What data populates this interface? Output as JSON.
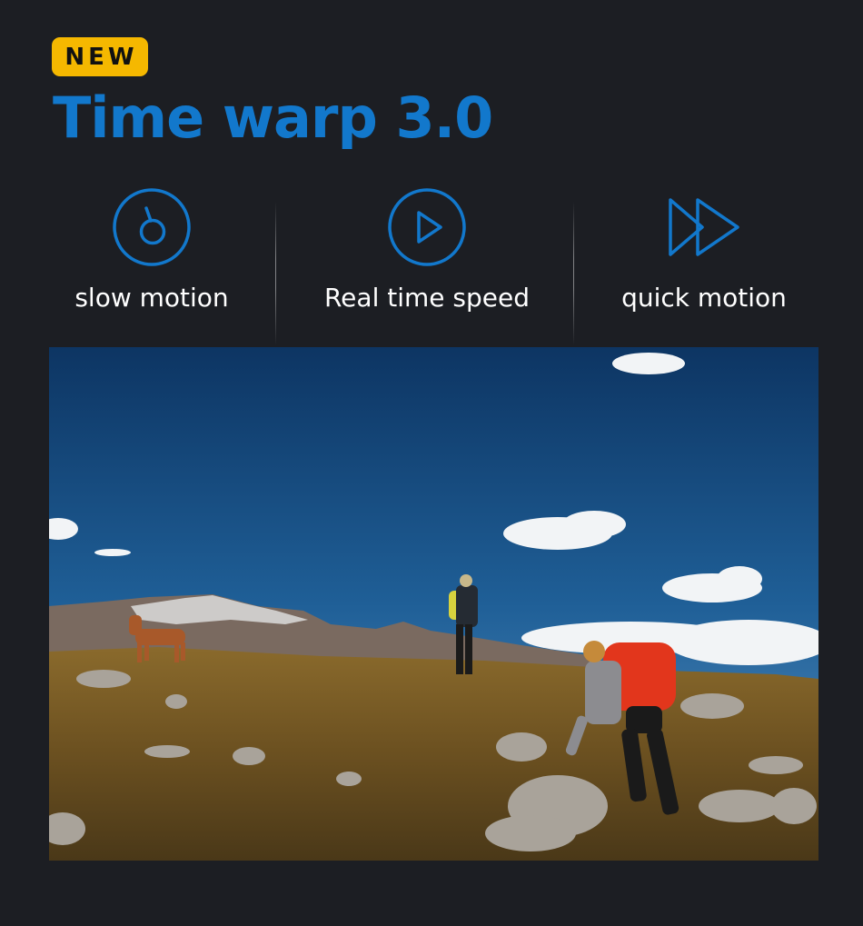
{
  "badge": {
    "label": "NEW"
  },
  "header": {
    "title": "Time warp 3.0"
  },
  "features": [
    {
      "label": "slow motion",
      "icon": "slow-motion-icon"
    },
    {
      "label": "Real time speed",
      "icon": "play-icon"
    },
    {
      "label": "quick motion",
      "icon": "fast-forward-icon"
    }
  ],
  "colors": {
    "background": "#1c1e23",
    "accent": "#1278cc",
    "badge": "#f5b800",
    "text": "#ffffff"
  },
  "photo": {
    "subject": "hiking-photo"
  }
}
